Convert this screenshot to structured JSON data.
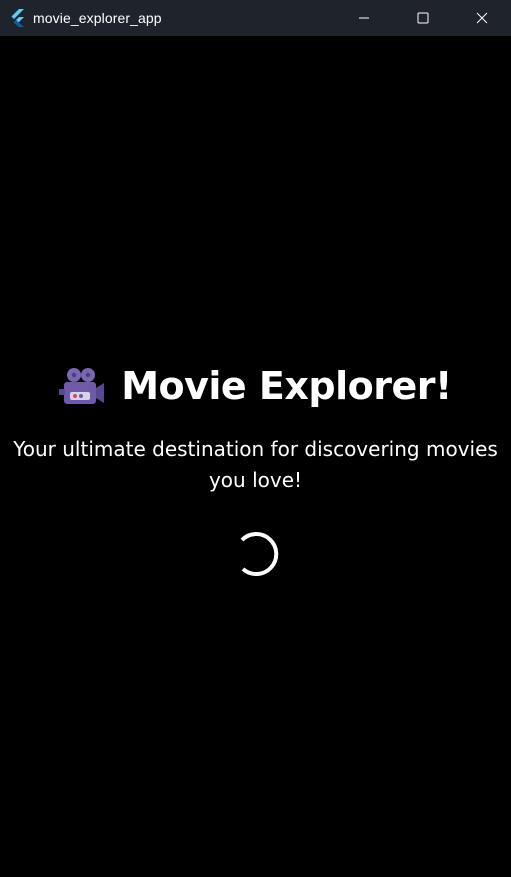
{
  "window": {
    "title": "movie_explorer_app",
    "logo_icon": "flutter-logo-icon",
    "controls": {
      "minimize_icon": "minimize-icon",
      "maximize_icon": "maximize-icon",
      "close_icon": "close-icon"
    }
  },
  "splash": {
    "icon": "movie-camera-icon",
    "heading": "Movie Explorer!",
    "subtitle": "Your ultimate destination for discovering movies you love!",
    "loading_indicator": "spinner-icon"
  },
  "colors": {
    "background": "#000000",
    "titlebar": "#1f242c",
    "text": "#ffffff",
    "camera_body": "#6e5aa8",
    "flutter_light": "#5fc9f8",
    "flutter_dark": "#0b5fa3"
  }
}
